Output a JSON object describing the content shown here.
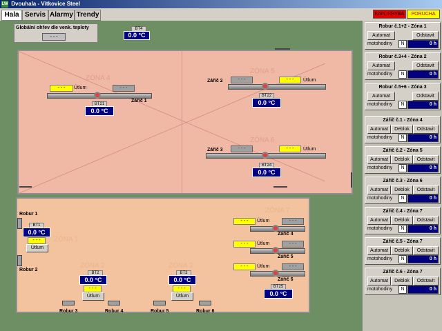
{
  "app": {
    "title": "Dvouhala - Vítkovice Steel",
    "icon_text": "LW"
  },
  "tabs": [
    {
      "label": "Hala"
    },
    {
      "label": "Servis"
    },
    {
      "label": "Alarmy"
    },
    {
      "label": "Trendy"
    }
  ],
  "indicators": {
    "comm": "Kom. CHYBA",
    "fault": "PORUCHA",
    "comm_color": "#e00000",
    "fault_color": "#ffff00"
  },
  "global": {
    "label": "Globální ohřev dle venk. teploty",
    "value": "- - -"
  },
  "bt4": {
    "label": "BT4",
    "value": "0.0 °C"
  },
  "zones": {
    "z4": "ZÓNA 4",
    "z5": "ZÓNA 5",
    "z6": "ZÓNA 6",
    "z7": "ZÓNA 7",
    "z1": "ZÓNA 1",
    "z2": "ZÓNA 2",
    "z3": "ZÓNA 3"
  },
  "heaters": {
    "h1": {
      "label": "Zářič 1",
      "yellow": "- - -",
      "utlum": "Útlum",
      "grey": "- - -"
    },
    "h2": {
      "label": "Zářič 2",
      "grey": "- - -",
      "yellow": "- - -",
      "utlum": "Útlum"
    },
    "h3": {
      "label": "Zářič 3",
      "grey": "- - -",
      "yellow": "- - -",
      "utlum": "Útlum"
    },
    "h4": {
      "label": "Zářič 4",
      "yellow": "- - -",
      "utlum": "Útlum",
      "grey": "- - -"
    },
    "h5": {
      "label": "Zářič 5",
      "yellow": "- - -",
      "utlum": "Útlum",
      "grey": "- - -"
    },
    "h6": {
      "label": "Zářič 6",
      "yellow": "- - -",
      "utlum": "Útlum",
      "grey": "- - -"
    }
  },
  "sensors": {
    "bt21": {
      "label": "BT21",
      "value": "0.0 °C"
    },
    "bt22": {
      "label": "BT22",
      "value": "0.0 °C"
    },
    "bt24": {
      "label": "BT24",
      "value": "0.0 °C"
    },
    "bt25": {
      "label": "BT25",
      "value": "0.0 °C"
    },
    "bt1": {
      "label": "BT1",
      "value": "0.0 °C",
      "yellow": "- - -",
      "utlum": "Útlum"
    },
    "bt2": {
      "label": "BT2",
      "value": "0.0 °C",
      "yellow": "- - -",
      "utlum": "Útlum"
    },
    "bt3": {
      "label": "BT3",
      "value": "0.0 °C",
      "yellow": "- - -",
      "utlum": "Útlum"
    }
  },
  "robur": {
    "r1": "Robur 1",
    "r2": "Robur 2",
    "r3": "Robur 3",
    "r4": "Robur 4",
    "r5": "Robur 5",
    "r6": "Robur 6"
  },
  "panel": {
    "sections": [
      {
        "title": "Robur č.1+2 - Zóna 1",
        "btn1": "Automat",
        "btn2": "Odstavit",
        "mot": "motohodiny",
        "n": "N",
        "hours": "0 h"
      },
      {
        "title": "Robur č.3+4 - Zóna 2",
        "btn1": "Automat",
        "btn2": "Odstavit",
        "mot": "motohodiny",
        "n": "N",
        "hours": "0 h"
      },
      {
        "title": "Robur č.5+6 - Zóna 3",
        "btn1": "Automat",
        "btn2": "Odstavit",
        "mot": "motohodiny",
        "n": "N",
        "hours": "0 h"
      },
      {
        "title": "Zářič č.1 - Zóna 4",
        "btn1": "Automat",
        "btnm": "Deblok",
        "btn2": "Odstavit",
        "mot": "motohodiny",
        "n": "N",
        "hours": "0 h"
      },
      {
        "title": "Zářič č.2 - Zóna 5",
        "btn1": "Automat",
        "btnm": "Deblok",
        "btn2": "Odstavit",
        "mot": "motohodiny",
        "n": "N",
        "hours": "0 h"
      },
      {
        "title": "Zářič č.3 - Zóna 6",
        "btn1": "Automat",
        "btnm": "Deblok",
        "btn2": "Odstavit",
        "mot": "motohodiny",
        "n": "N",
        "hours": "0 h"
      },
      {
        "title": "Zářič č.4 - Zóna 7",
        "btn1": "Automat",
        "btnm": "Deblok",
        "btn2": "Odstavit",
        "mot": "motohodiny",
        "n": "N",
        "hours": "0 h"
      },
      {
        "title": "Zářič č.5 - Zóna 7",
        "btn1": "Automat",
        "btnm": "Deblok",
        "btn2": "Odstavit",
        "mot": "motohodiny",
        "n": "N",
        "hours": "0 h"
      },
      {
        "title": "Zářič č.6 - Zóna 7",
        "btn1": "Automat",
        "btnm": "Deblok",
        "btn2": "Odstavit",
        "mot": "motohodiny",
        "n": "N",
        "hours": "0 h"
      }
    ]
  }
}
